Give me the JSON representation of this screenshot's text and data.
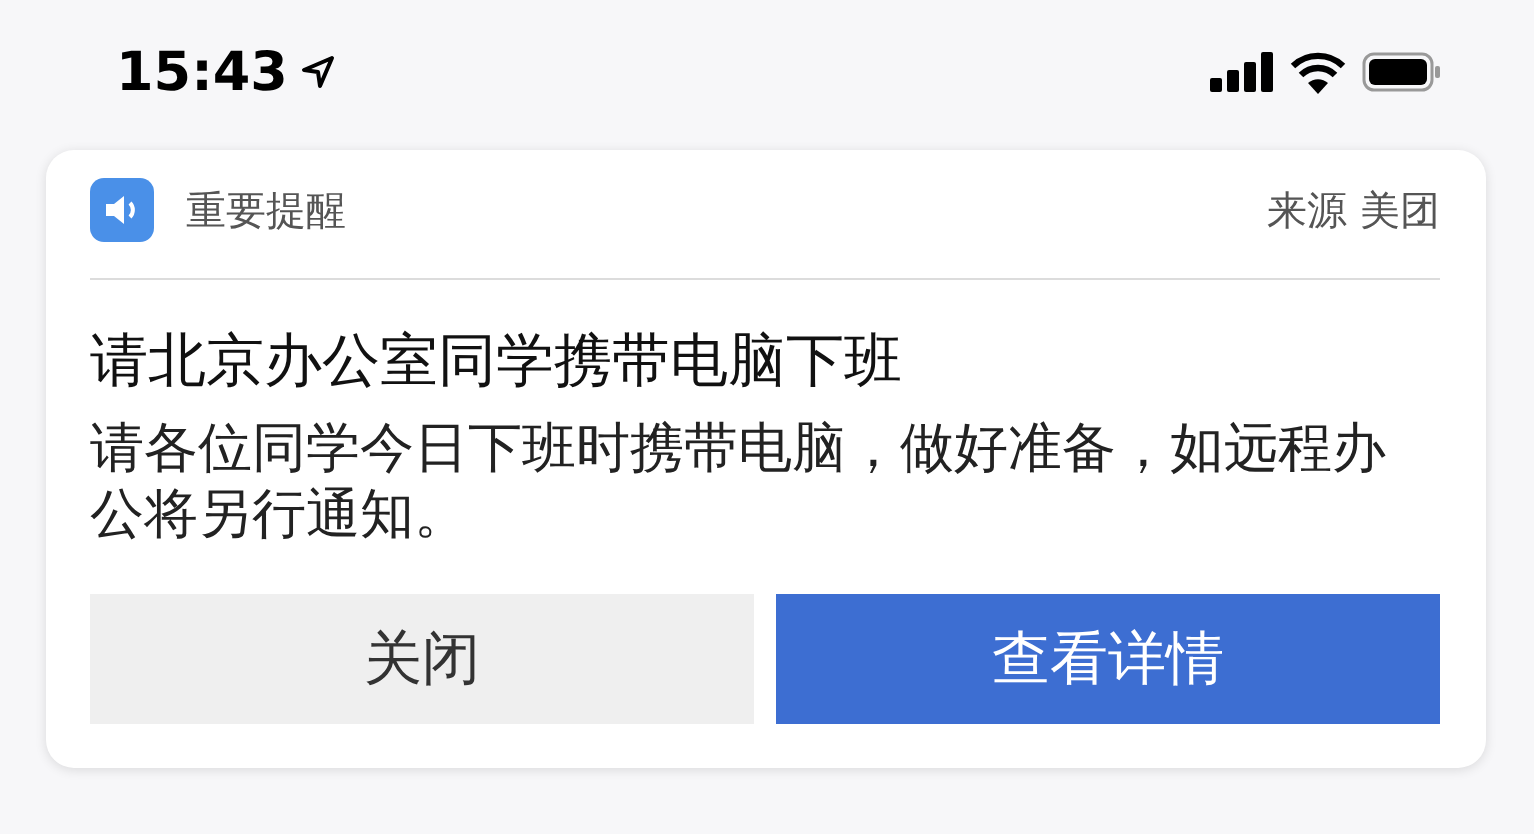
{
  "status_bar": {
    "time": "15:43"
  },
  "notification": {
    "app_name": "重要提醒",
    "source": "来源 美团",
    "title": "请北京办公室同学携带电脑下班",
    "body": "请各位同学今日下班时携带电脑，做好准备，如远程办公将另行通知。",
    "buttons": [
      {
        "label": "关闭",
        "kind": "secondary"
      },
      {
        "label": "查看详情",
        "kind": "primary"
      }
    ]
  }
}
